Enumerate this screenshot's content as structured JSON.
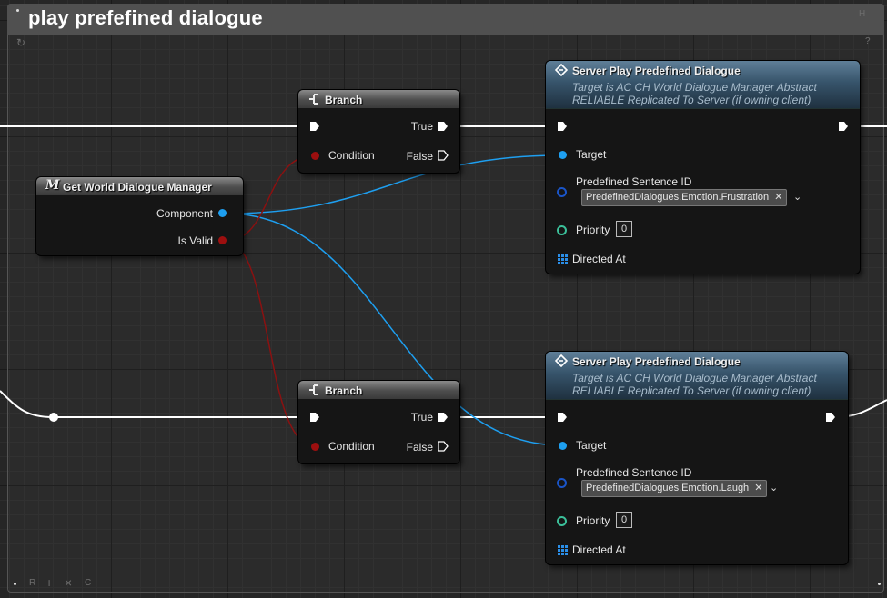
{
  "comment": {
    "title": "play prefefined dialogue",
    "corner_letter": "H",
    "corner_q": "?",
    "bottom_icons": [
      "R",
      "+",
      "×",
      "C"
    ]
  },
  "colors": {
    "exec_wire": "#ffffff",
    "object_wire": "#1e9ff0",
    "bool_wire": "#8a1111",
    "server_header": "#3f5d73",
    "branch_header": "#6a6a6a"
  },
  "get_node": {
    "title": "Get World Dialogue Manager",
    "icon": "macro-icon",
    "icon_glyph": "M",
    "component_label": "Component",
    "is_valid_label": "Is Valid"
  },
  "branch_top": {
    "title": "Branch",
    "icon": "branch-icon",
    "true_label": "True",
    "false_label": "False",
    "condition_label": "Condition"
  },
  "branch_bottom": {
    "title": "Branch",
    "icon": "branch-icon",
    "true_label": "True",
    "false_label": "False",
    "condition_label": "Condition"
  },
  "server_top": {
    "title": "Server Play Predefined Dialogue",
    "icon": "function-icon",
    "subtitle1": "Target is AC CH World Dialogue Manager Abstract",
    "subtitle2": "RELIABLE Replicated To Server (if owning client)",
    "target_label": "Target",
    "sentence_label": "Predefined Sentence ID",
    "sentence_value": "PredefinedDialogues.Emotion.Frustration",
    "priority_label": "Priority",
    "priority_value": "0",
    "directed_label": "Directed At"
  },
  "server_bottom": {
    "title": "Server Play Predefined Dialogue",
    "icon": "function-icon",
    "subtitle1": "Target is AC CH World Dialogue Manager Abstract",
    "subtitle2": "RELIABLE Replicated To Server (if owning client)",
    "target_label": "Target",
    "sentence_label": "Predefined Sentence ID",
    "sentence_value": "PredefinedDialogues.Emotion.Laugh",
    "priority_label": "Priority",
    "priority_value": "0",
    "directed_label": "Directed At"
  }
}
